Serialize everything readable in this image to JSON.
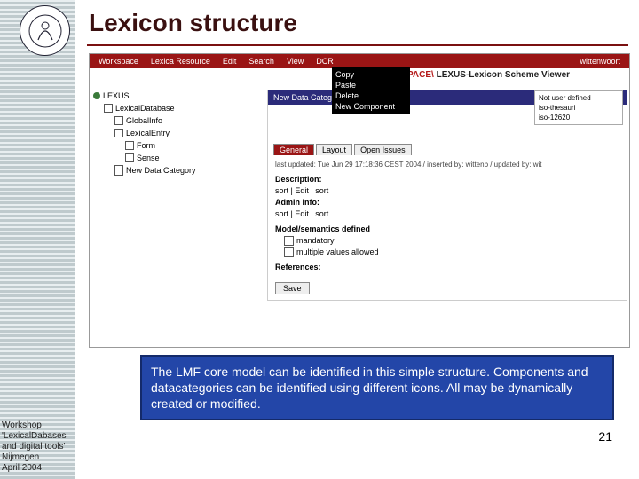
{
  "slide": {
    "title": "Lexicon structure",
    "caption": "The LMF core model can be identified in this simple structure. Components and datacategories can be identified using different icons. All may be dynamically created or modified.",
    "footer_line1": "Workshop",
    "footer_line2": "'LexicalDabases",
    "footer_line3": "and digital tools'",
    "footer_line4": "Nijmegen",
    "footer_line5": "April 2004",
    "page_number": "21"
  },
  "menubar": {
    "items": [
      "Workspace",
      "Lexica Resource",
      "Edit",
      "Search",
      "View",
      "DCR"
    ],
    "user": "wittenwoort"
  },
  "context_menu": {
    "items": [
      "Copy",
      "Paste",
      "Delete",
      "New Component"
    ]
  },
  "window": {
    "title_prefix": "PACE\\",
    "title": "LEXUS-Lexicon Scheme Viewer"
  },
  "tree": {
    "root": "LEXUS",
    "items": [
      {
        "label": "LexicalDatabase",
        "indent": 1
      },
      {
        "label": "GlobalInfo",
        "indent": 2
      },
      {
        "label": "LexicalEntry",
        "indent": 2
      },
      {
        "label": "Form",
        "indent": 3
      },
      {
        "label": "Sense",
        "indent": 3
      },
      {
        "label": "New Data Category",
        "indent": 2
      }
    ]
  },
  "panel": {
    "new_data_label": "New Data Category",
    "meta": {
      "line1": "Not user defined",
      "line2": "iso-thesauri",
      "line3": "iso-12620"
    },
    "tabs": [
      "General",
      "Layout",
      "Open Issues"
    ],
    "updated": "last updated: Tue Jun 29 17:18:36 CEST 2004 / inserted by: wittenb / updated by: wit",
    "desc_label": "Description:",
    "desc_action": "sort | Edit | sort",
    "admin_label": "Admin Info:",
    "admin_action": "sort | Edit | sort",
    "model_label": "Model/semantics defined",
    "chk1": "mandatory",
    "chk2": "multiple values allowed",
    "refs_label": "References:",
    "save": "Save"
  }
}
